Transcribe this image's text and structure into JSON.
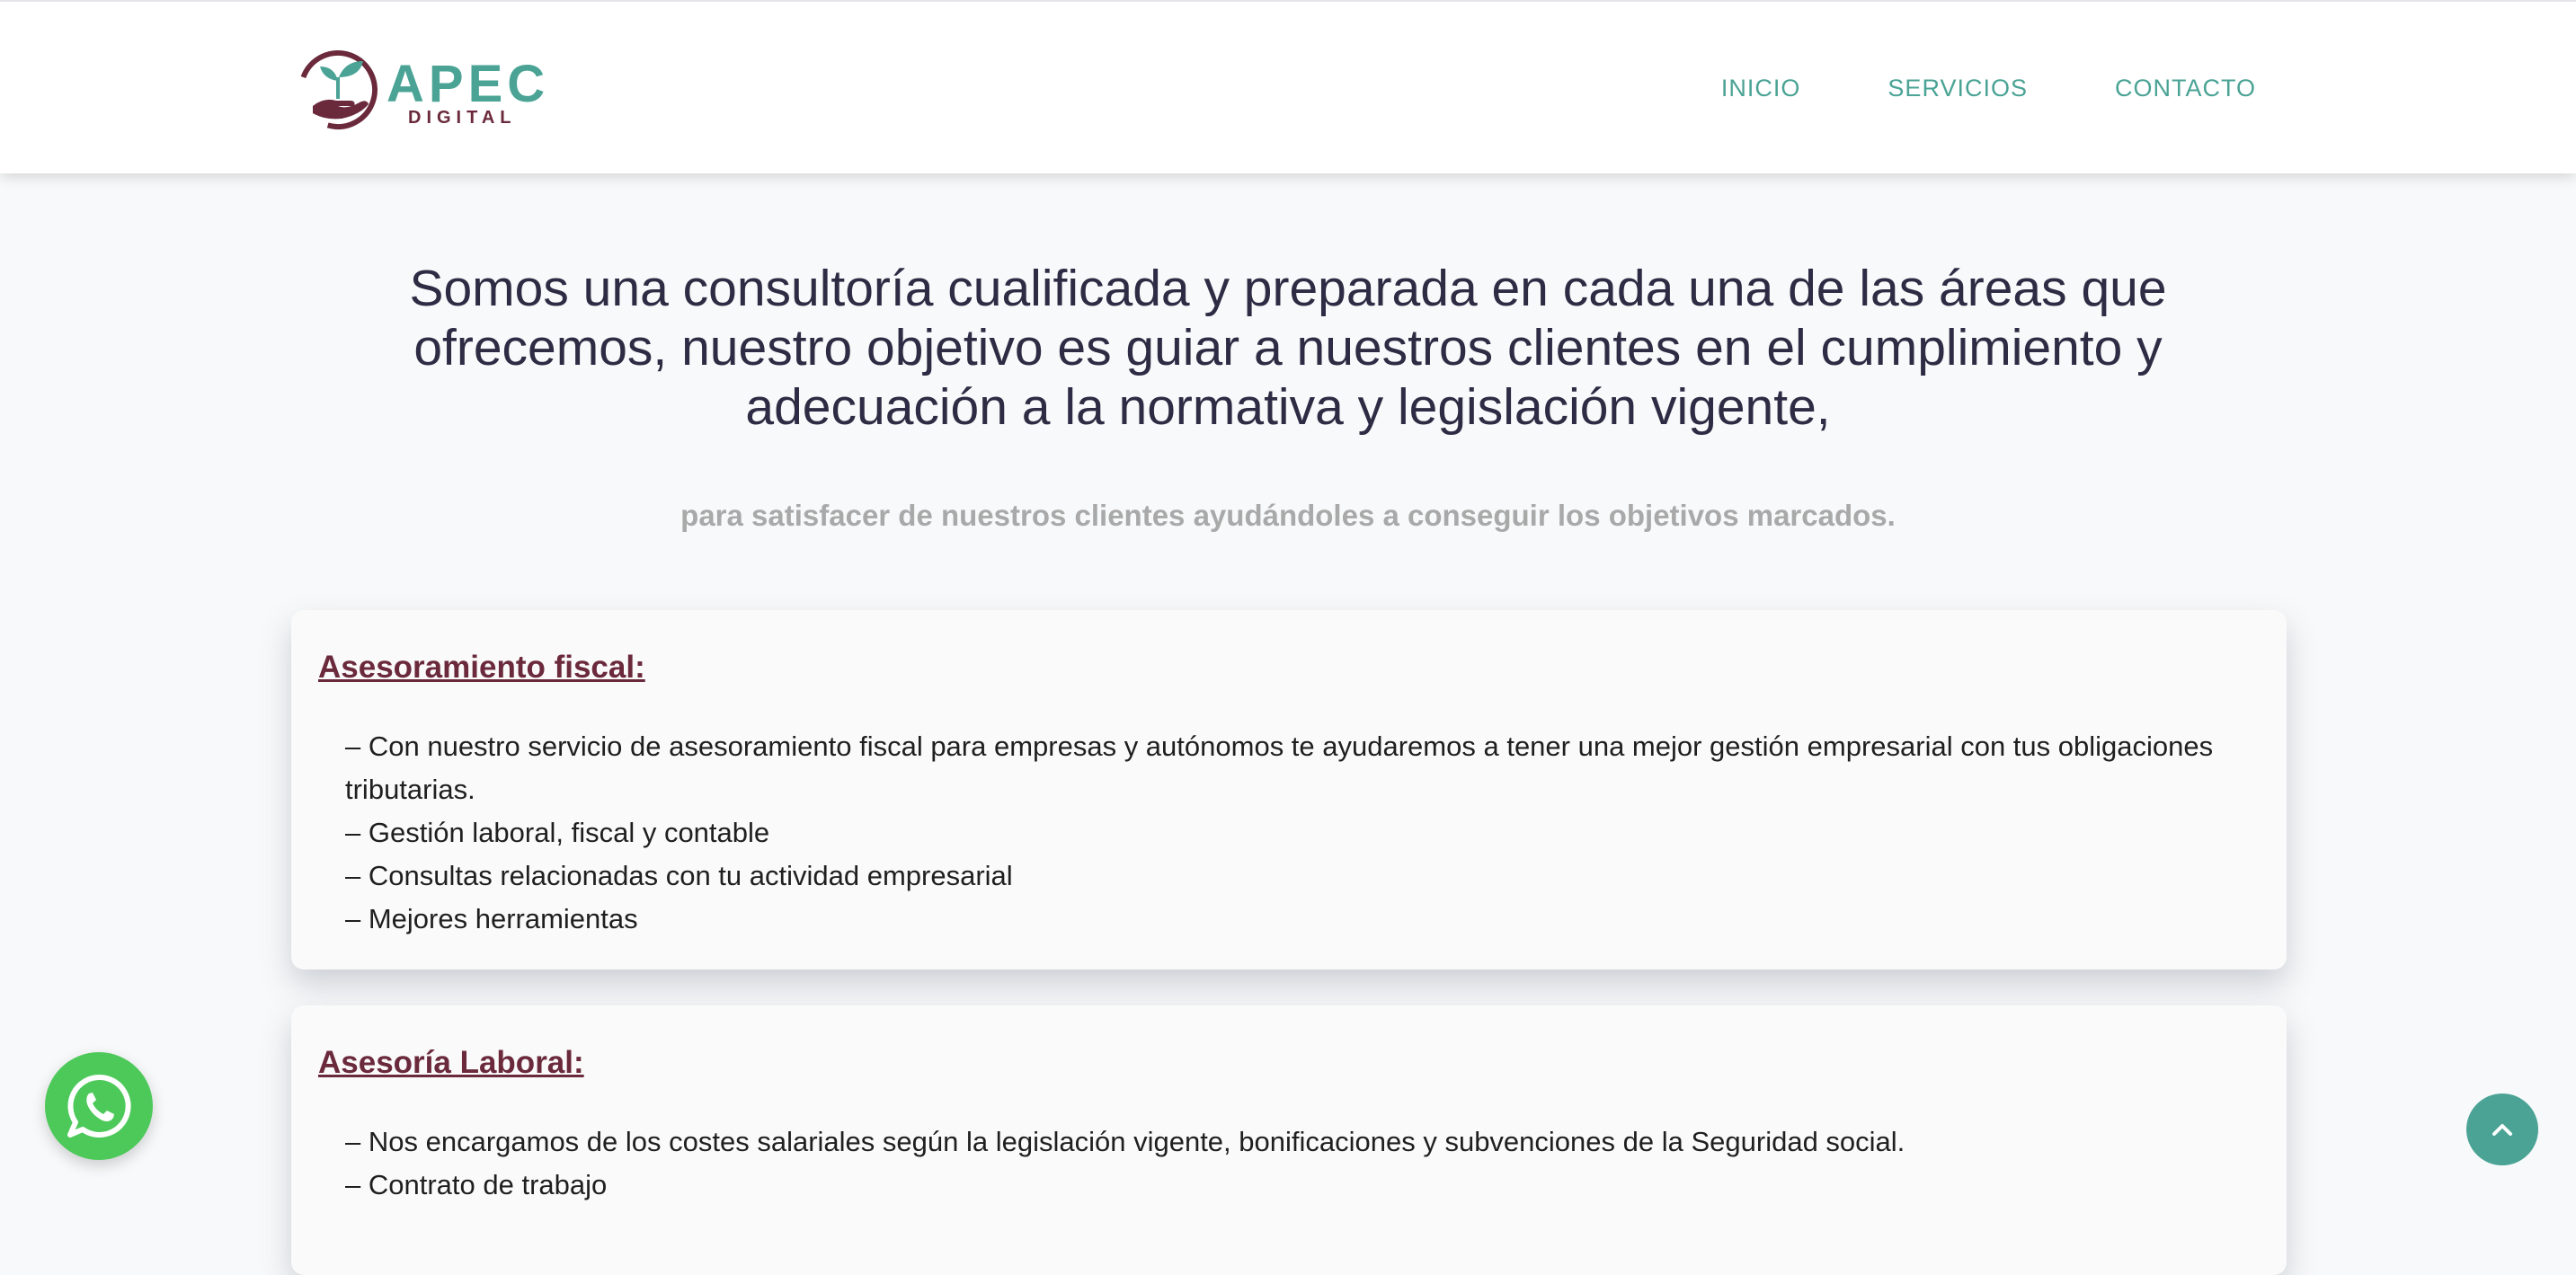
{
  "header": {
    "logo": {
      "main": "APEC",
      "sub": "DIGITAL"
    },
    "nav": [
      {
        "label": "INICIO"
      },
      {
        "label": "SERVICIOS"
      },
      {
        "label": "CONTACTO"
      }
    ]
  },
  "intro": {
    "headline": "Somos una consultoría cualificada y preparada en cada una de las áreas que ofrecemos, nuestro objetivo es guiar a nuestros clientes en el cumplimiento y adecuación a la normativa y legislación vigente,",
    "subline": "para satisfacer de nuestros clientes ayudándoles a conseguir los objetivos marcados."
  },
  "services": [
    {
      "title": "Asesoramiento fiscal:",
      "items": [
        "– Con nuestro servicio de asesoramiento fiscal para empresas y autónomos te ayudaremos a tener una mejor gestión empresarial con tus obligaciones tributarias.",
        "– Gestión laboral, fiscal y contable",
        "– Consultas relacionadas con tu actividad empresarial",
        "– Mejores herramientas"
      ]
    },
    {
      "title": "Asesoría Laboral:",
      "items": [
        "– Nos encargamos de los costes salariales según la legislación vigente, bonificaciones y subvenciones de la Seguridad social.",
        "– Contrato de trabajo"
      ]
    }
  ],
  "floating": {
    "whatsapp_icon": "whatsapp-icon",
    "totop_icon": "chevron-up-icon"
  },
  "colors": {
    "brand_teal": "#4aa395",
    "brand_burgundy": "#6b2a3c",
    "headline": "#2d2c44",
    "whatsapp_green": "#4dc95a"
  }
}
